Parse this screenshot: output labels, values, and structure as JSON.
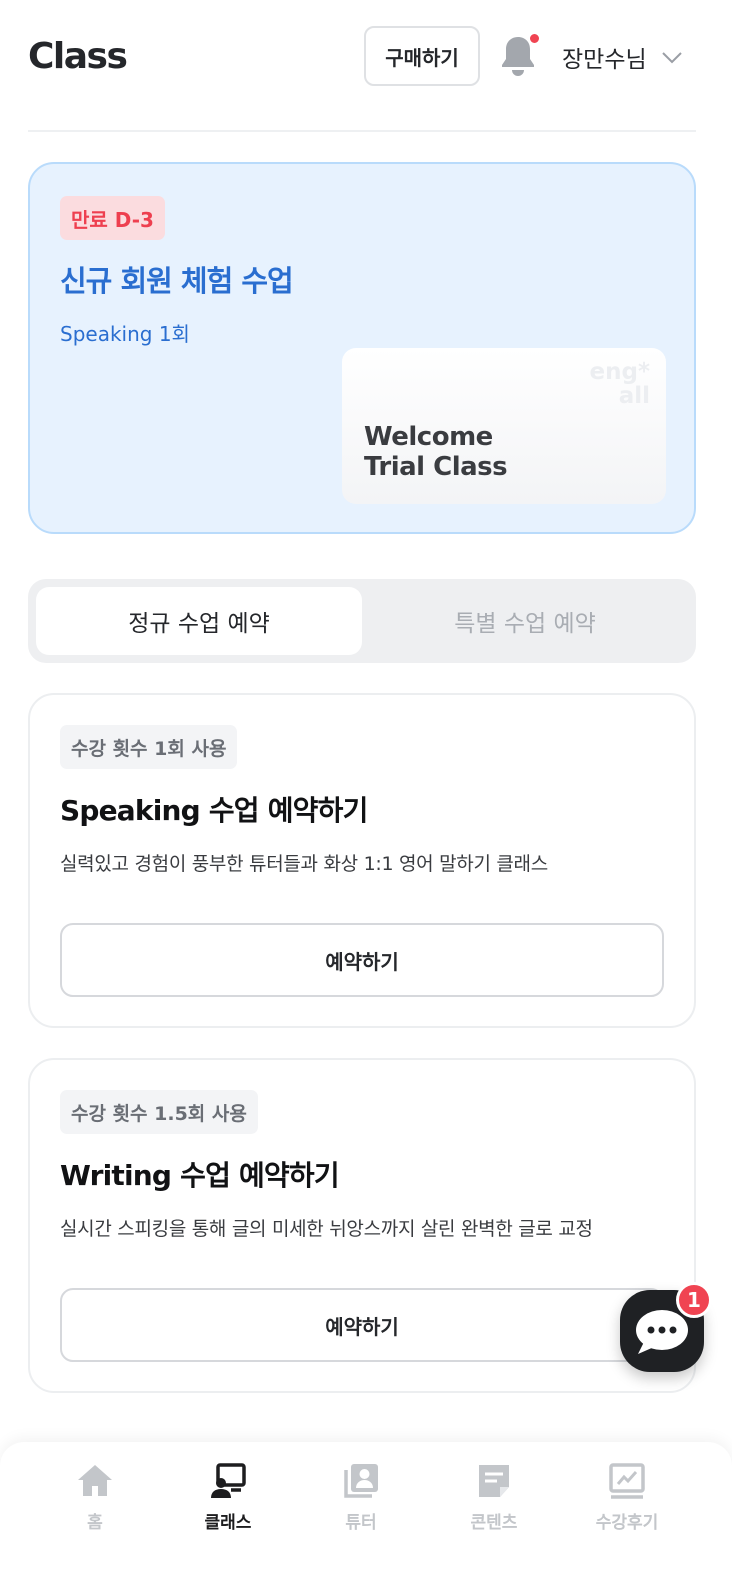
{
  "header": {
    "brand": "Class",
    "buy_label": "구매하기",
    "user_name": "장만수님"
  },
  "trial": {
    "badge": "만료 D-3",
    "title": "신규 회원 체험 수업",
    "subtitle": "Speaking 1회",
    "thumb_logo_line1": "eng*",
    "thumb_logo_line2": "all",
    "thumb_line1": "Welcome",
    "thumb_line2": "Trial Class"
  },
  "tabs": {
    "regular": "정규 수업 예약",
    "special": "특별 수업 예약"
  },
  "classes": [
    {
      "usage": "수강 횟수 1회 사용",
      "title": "Speaking 수업 예약하기",
      "desc": "실력있고 경험이 풍부한 튜터들과 화상 1:1 영어 말하기 클래스",
      "button": "예약하기"
    },
    {
      "usage": "수강 횟수 1.5회 사용",
      "title": "Writing 수업 예약하기",
      "desc": "실시간 스피킹을 통해 글의 미세한 뉘앙스까지 살린 완벽한 글로 교정",
      "button": "예약하기"
    }
  ],
  "chat": {
    "badge": "1"
  },
  "nav": {
    "items": [
      {
        "label": "홈",
        "icon": "home-icon"
      },
      {
        "label": "클래스",
        "icon": "class-icon",
        "active": true
      },
      {
        "label": "튜터",
        "icon": "tutor-icon"
      },
      {
        "label": "콘텐츠",
        "icon": "content-icon"
      },
      {
        "label": "수강후기",
        "icon": "review-icon"
      }
    ]
  },
  "colors": {
    "accent_blue": "#2a6ed0",
    "badge_red": "#ee3f4f",
    "notify_red": "#f04452"
  }
}
